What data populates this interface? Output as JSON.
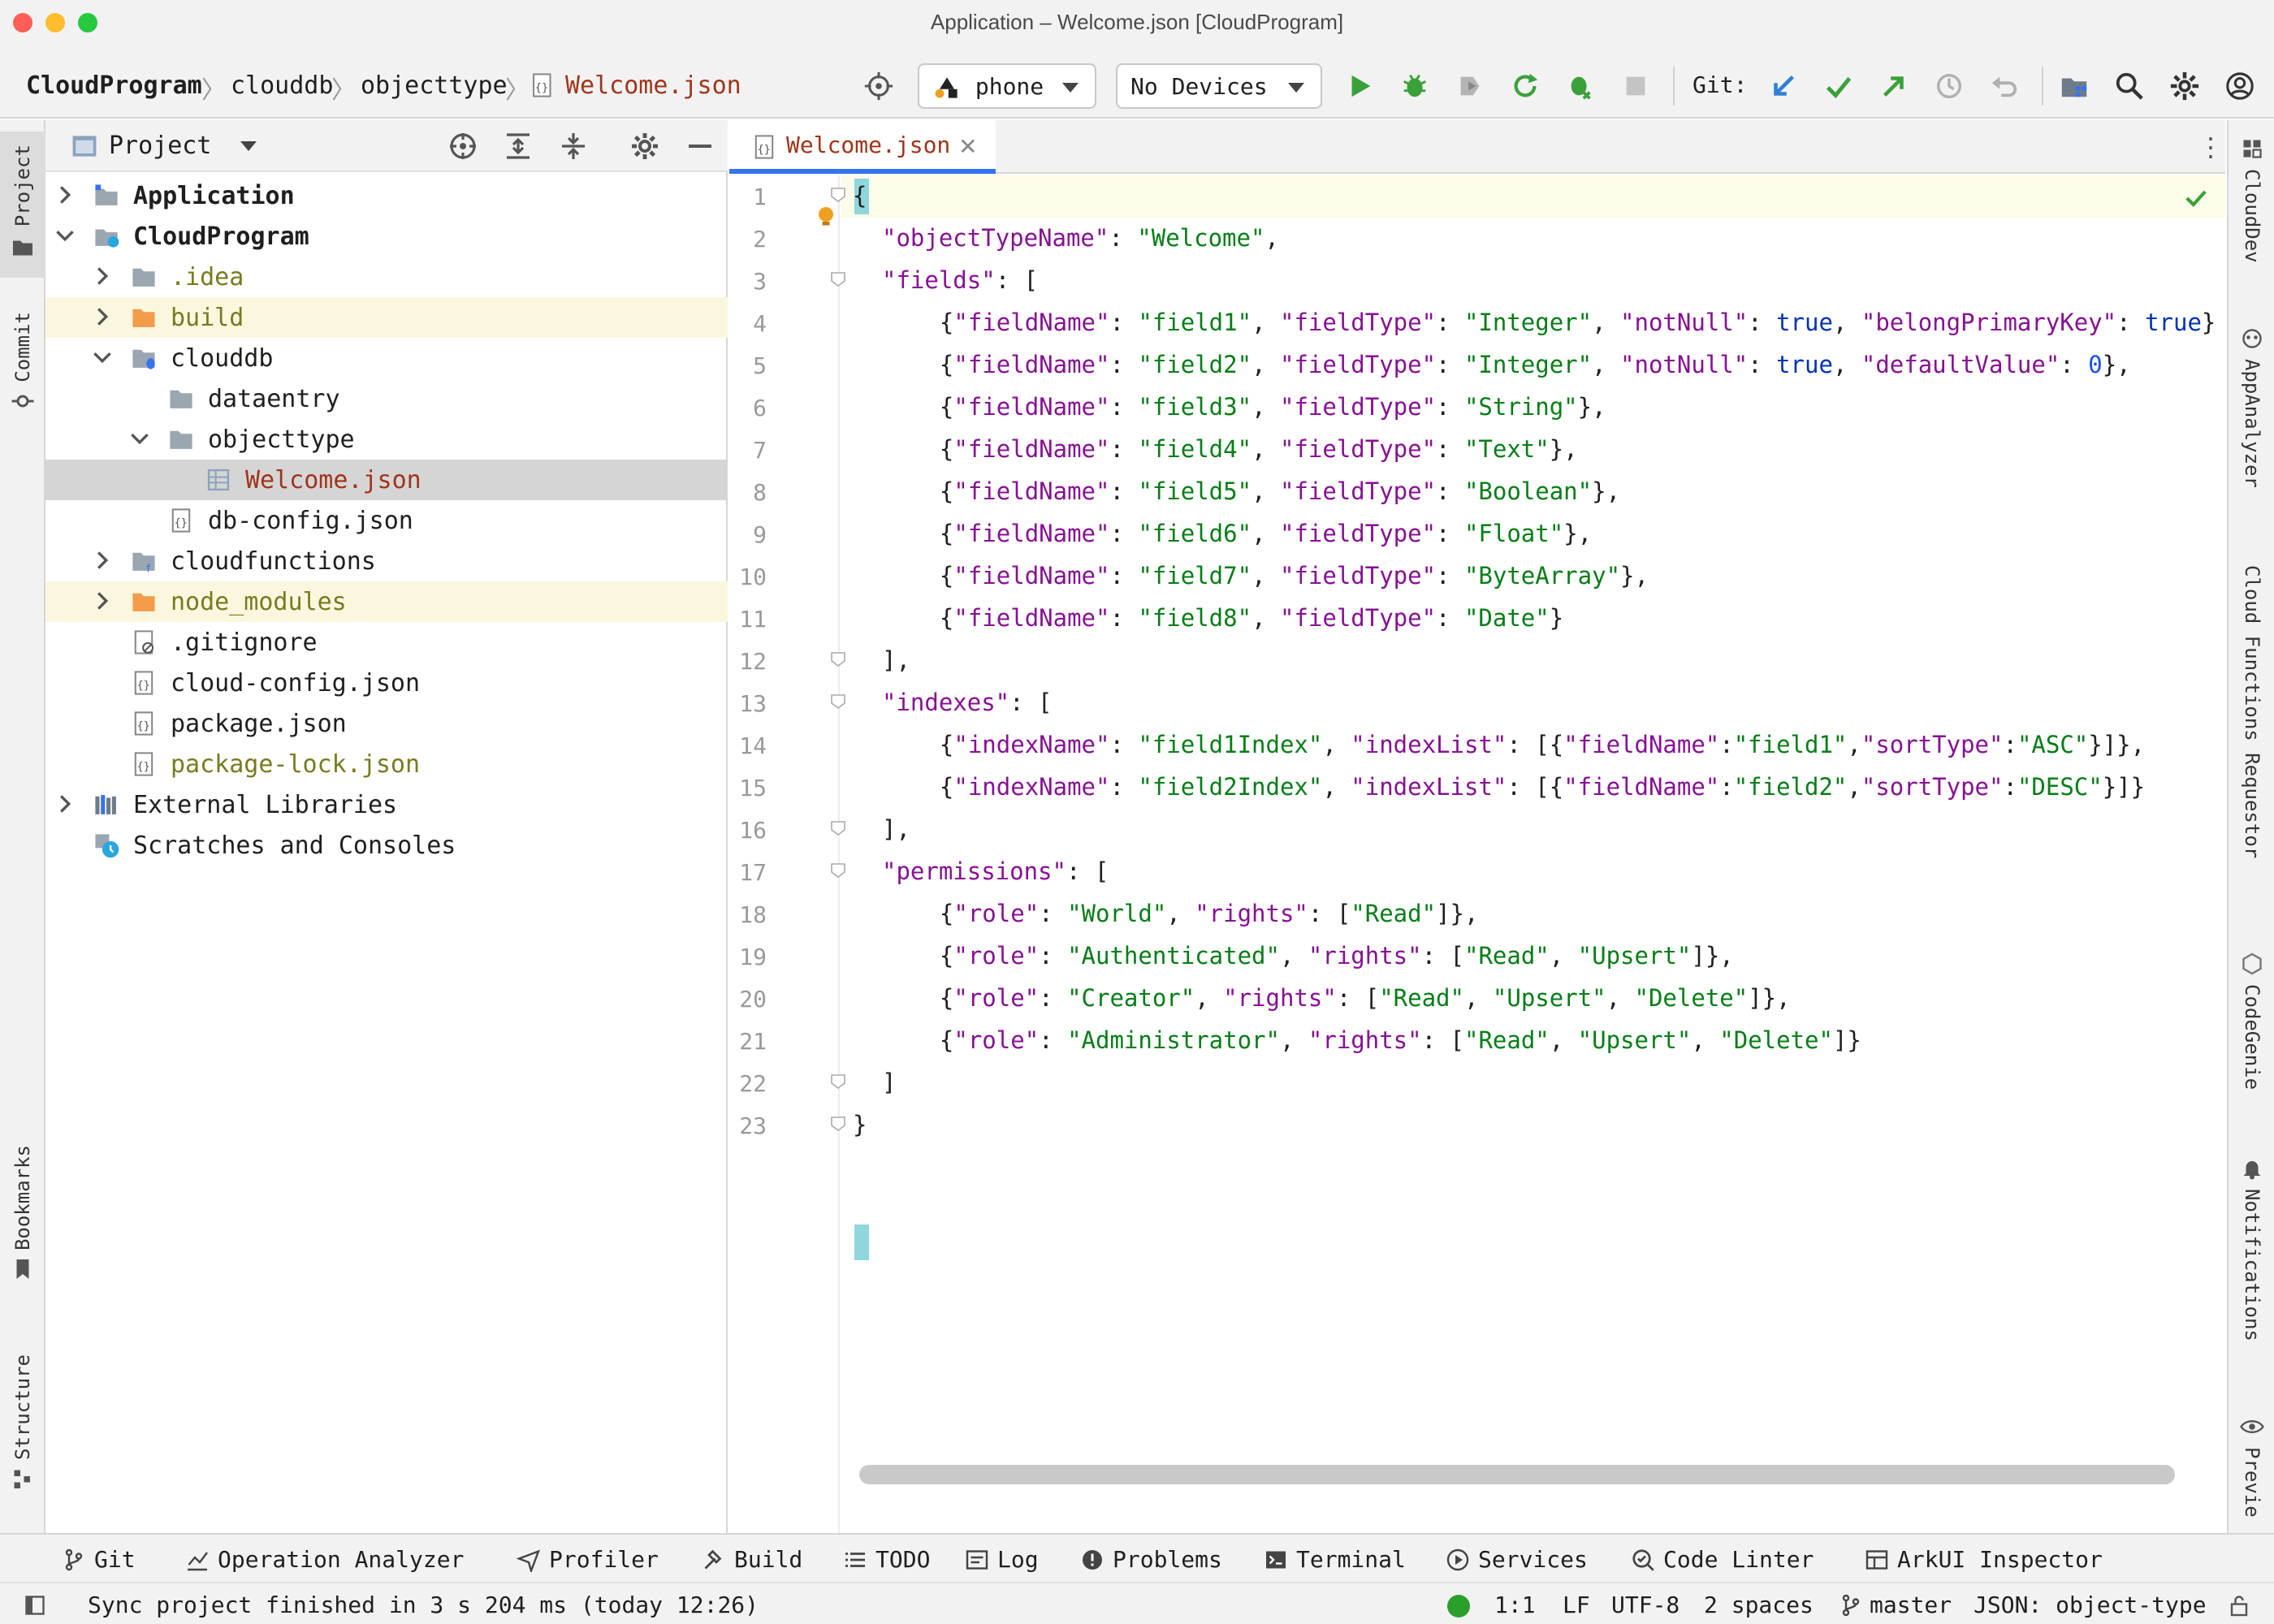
{
  "window": {
    "title": "Application – Welcome.json [CloudProgram]"
  },
  "colors": {
    "close": "#ff5f57",
    "minimize": "#febc2e",
    "zoom": "#28c840",
    "accent": "#3574f0",
    "run_green": "#3aa13a",
    "folder_orange": "#f39c4a",
    "folder_gray": "#9aa7b0"
  },
  "toolbar": {
    "breadcrumbs": [
      "CloudProgram",
      "clouddb",
      "objecttype",
      "Welcome.json"
    ],
    "device_select": "phone",
    "device_target": "No Devices",
    "git_label": "Git:"
  },
  "left_stripe": {
    "tabs": [
      "Project",
      "Commit",
      "Bookmarks",
      "Structure"
    ]
  },
  "project_panel": {
    "title": "Project",
    "tree": [
      {
        "label": "Application",
        "icon": "module-icon",
        "expanded": false
      },
      {
        "label": "CloudProgram",
        "icon": "module-icon",
        "expanded": true
      },
      {
        "label": ".idea",
        "icon": "folder-icon",
        "expanded": false
      },
      {
        "label": "build",
        "icon": "folder-icon",
        "expanded": false
      },
      {
        "label": "clouddb",
        "icon": "db-folder-icon",
        "expanded": true
      },
      {
        "label": "dataentry",
        "icon": "folder-icon"
      },
      {
        "label": "objecttype",
        "icon": "folder-icon",
        "expanded": true
      },
      {
        "label": "Welcome.json",
        "icon": "table-file-icon"
      },
      {
        "label": "db-config.json",
        "icon": "json-file-icon"
      },
      {
        "label": "cloudfunctions",
        "icon": "functions-folder-icon",
        "expanded": false
      },
      {
        "label": "node_modules",
        "icon": "folder-icon",
        "expanded": false
      },
      {
        "label": ".gitignore",
        "icon": "ignore-file-icon"
      },
      {
        "label": "cloud-config.json",
        "icon": "json-file-icon"
      },
      {
        "label": "package.json",
        "icon": "json-file-icon"
      },
      {
        "label": "package-lock.json",
        "icon": "json-file-icon"
      },
      {
        "label": "External Libraries",
        "icon": "libraries-icon",
        "expanded": false
      },
      {
        "label": "Scratches and Consoles",
        "icon": "scratches-icon"
      }
    ]
  },
  "editor": {
    "tab_label": "Welcome.json",
    "line_numbers": [
      "1",
      "2",
      "3",
      "4",
      "5",
      "6",
      "7",
      "8",
      "9",
      "10",
      "11",
      "12",
      "13",
      "14",
      "15",
      "16",
      "17",
      "18",
      "19",
      "20",
      "21",
      "22",
      "23"
    ],
    "lines": [
      [
        [
          "p",
          "{"
        ]
      ],
      [
        [
          "k",
          "\"objectTypeName\""
        ],
        [
          "p",
          ": "
        ],
        [
          "s",
          "\"Welcome\""
        ],
        [
          "p",
          ","
        ]
      ],
      [
        [
          "k",
          "\"fields\""
        ],
        [
          "p",
          ": ["
        ]
      ],
      [
        [
          "p",
          "  {"
        ],
        [
          "k",
          "\"fieldName\""
        ],
        [
          "p",
          ": "
        ],
        [
          "s",
          "\"field1\""
        ],
        [
          "p",
          ", "
        ],
        [
          "k",
          "\"fieldType\""
        ],
        [
          "p",
          ": "
        ],
        [
          "s",
          "\"Integer\""
        ],
        [
          "p",
          ", "
        ],
        [
          "k",
          "\"notNull\""
        ],
        [
          "p",
          ": "
        ],
        [
          "b",
          "true"
        ],
        [
          "p",
          ", "
        ],
        [
          "k",
          "\"belongPrimaryKey\""
        ],
        [
          "p",
          ": "
        ],
        [
          "b",
          "true"
        ],
        [
          "p",
          "}"
        ]
      ],
      [
        [
          "p",
          "  {"
        ],
        [
          "k",
          "\"fieldName\""
        ],
        [
          "p",
          ": "
        ],
        [
          "s",
          "\"field2\""
        ],
        [
          "p",
          ", "
        ],
        [
          "k",
          "\"fieldType\""
        ],
        [
          "p",
          ": "
        ],
        [
          "s",
          "\"Integer\""
        ],
        [
          "p",
          ", "
        ],
        [
          "k",
          "\"notNull\""
        ],
        [
          "p",
          ": "
        ],
        [
          "b",
          "true"
        ],
        [
          "p",
          ", "
        ],
        [
          "k",
          "\"defaultValue\""
        ],
        [
          "p",
          ": "
        ],
        [
          "n",
          "0"
        ],
        [
          "p",
          "},"
        ]
      ],
      [
        [
          "p",
          "  {"
        ],
        [
          "k",
          "\"fieldName\""
        ],
        [
          "p",
          ": "
        ],
        [
          "s",
          "\"field3\""
        ],
        [
          "p",
          ", "
        ],
        [
          "k",
          "\"fieldType\""
        ],
        [
          "p",
          ": "
        ],
        [
          "s",
          "\"String\""
        ],
        [
          "p",
          "},"
        ]
      ],
      [
        [
          "p",
          "  {"
        ],
        [
          "k",
          "\"fieldName\""
        ],
        [
          "p",
          ": "
        ],
        [
          "s",
          "\"field4\""
        ],
        [
          "p",
          ", "
        ],
        [
          "k",
          "\"fieldType\""
        ],
        [
          "p",
          ": "
        ],
        [
          "s",
          "\"Text\""
        ],
        [
          "p",
          "},"
        ]
      ],
      [
        [
          "p",
          "  {"
        ],
        [
          "k",
          "\"fieldName\""
        ],
        [
          "p",
          ": "
        ],
        [
          "s",
          "\"field5\""
        ],
        [
          "p",
          ", "
        ],
        [
          "k",
          "\"fieldType\""
        ],
        [
          "p",
          ": "
        ],
        [
          "s",
          "\"Boolean\""
        ],
        [
          "p",
          "},"
        ]
      ],
      [
        [
          "p",
          "  {"
        ],
        [
          "k",
          "\"fieldName\""
        ],
        [
          "p",
          ": "
        ],
        [
          "s",
          "\"field6\""
        ],
        [
          "p",
          ", "
        ],
        [
          "k",
          "\"fieldType\""
        ],
        [
          "p",
          ": "
        ],
        [
          "s",
          "\"Float\""
        ],
        [
          "p",
          "},"
        ]
      ],
      [
        [
          "p",
          "  {"
        ],
        [
          "k",
          "\"fieldName\""
        ],
        [
          "p",
          ": "
        ],
        [
          "s",
          "\"field7\""
        ],
        [
          "p",
          ", "
        ],
        [
          "k",
          "\"fieldType\""
        ],
        [
          "p",
          ": "
        ],
        [
          "s",
          "\"ByteArray\""
        ],
        [
          "p",
          "},"
        ]
      ],
      [
        [
          "p",
          "  {"
        ],
        [
          "k",
          "\"fieldName\""
        ],
        [
          "p",
          ": "
        ],
        [
          "s",
          "\"field8\""
        ],
        [
          "p",
          ", "
        ],
        [
          "k",
          "\"fieldType\""
        ],
        [
          "p",
          ": "
        ],
        [
          "s",
          "\"Date\""
        ],
        [
          "p",
          "}"
        ]
      ],
      [
        [
          "p",
          "],"
        ]
      ],
      [
        [
          "k",
          "\"indexes\""
        ],
        [
          "p",
          ": ["
        ]
      ],
      [
        [
          "p",
          "  {"
        ],
        [
          "k",
          "\"indexName\""
        ],
        [
          "p",
          ": "
        ],
        [
          "s",
          "\"field1Index\""
        ],
        [
          "p",
          ", "
        ],
        [
          "k",
          "\"indexList\""
        ],
        [
          "p",
          ": [{"
        ],
        [
          "k",
          "\"fieldName\""
        ],
        [
          "p",
          ":"
        ],
        [
          "s",
          "\"field1\""
        ],
        [
          "p",
          ","
        ],
        [
          "k",
          "\"sortType\""
        ],
        [
          "p",
          ":"
        ],
        [
          "s",
          "\"ASC\""
        ],
        [
          "p",
          "}]},"
        ]
      ],
      [
        [
          "p",
          "  {"
        ],
        [
          "k",
          "\"indexName\""
        ],
        [
          "p",
          ": "
        ],
        [
          "s",
          "\"field2Index\""
        ],
        [
          "p",
          ", "
        ],
        [
          "k",
          "\"indexList\""
        ],
        [
          "p",
          ": [{"
        ],
        [
          "k",
          "\"fieldName\""
        ],
        [
          "p",
          ":"
        ],
        [
          "s",
          "\"field2\""
        ],
        [
          "p",
          ","
        ],
        [
          "k",
          "\"sortType\""
        ],
        [
          "p",
          ":"
        ],
        [
          "s",
          "\"DESC\""
        ],
        [
          "p",
          "}]}"
        ]
      ],
      [
        [
          "p",
          "],"
        ]
      ],
      [
        [
          "k",
          "\"permissions\""
        ],
        [
          "p",
          ": ["
        ]
      ],
      [
        [
          "p",
          "  {"
        ],
        [
          "k",
          "\"role\""
        ],
        [
          "p",
          ": "
        ],
        [
          "s",
          "\"World\""
        ],
        [
          "p",
          ", "
        ],
        [
          "k",
          "\"rights\""
        ],
        [
          "p",
          ": ["
        ],
        [
          "s",
          "\"Read\""
        ],
        [
          "p",
          "]},"
        ]
      ],
      [
        [
          "p",
          "  {"
        ],
        [
          "k",
          "\"role\""
        ],
        [
          "p",
          ": "
        ],
        [
          "s",
          "\"Authenticated\""
        ],
        [
          "p",
          ", "
        ],
        [
          "k",
          "\"rights\""
        ],
        [
          "p",
          ": ["
        ],
        [
          "s",
          "\"Read\""
        ],
        [
          "p",
          ", "
        ],
        [
          "s",
          "\"Upsert\""
        ],
        [
          "p",
          "]},"
        ]
      ],
      [
        [
          "p",
          "  {"
        ],
        [
          "k",
          "\"role\""
        ],
        [
          "p",
          ": "
        ],
        [
          "s",
          "\"Creator\""
        ],
        [
          "p",
          ", "
        ],
        [
          "k",
          "\"rights\""
        ],
        [
          "p",
          ": ["
        ],
        [
          "s",
          "\"Read\""
        ],
        [
          "p",
          ", "
        ],
        [
          "s",
          "\"Upsert\""
        ],
        [
          "p",
          ", "
        ],
        [
          "s",
          "\"Delete\""
        ],
        [
          "p",
          "]},"
        ]
      ],
      [
        [
          "p",
          "  {"
        ],
        [
          "k",
          "\"role\""
        ],
        [
          "p",
          ": "
        ],
        [
          "s",
          "\"Administrator\""
        ],
        [
          "p",
          ", "
        ],
        [
          "k",
          "\"rights\""
        ],
        [
          "p",
          ": ["
        ],
        [
          "s",
          "\"Read\""
        ],
        [
          "p",
          ", "
        ],
        [
          "s",
          "\"Upsert\""
        ],
        [
          "p",
          ", "
        ],
        [
          "s",
          "\"Delete\""
        ],
        [
          "p",
          "]}"
        ]
      ],
      [
        [
          "p",
          "]"
        ]
      ],
      [
        [
          "p",
          "}"
        ]
      ]
    ]
  },
  "right_stripe": {
    "tabs": [
      "CloudDev",
      "AppAnalyzer",
      "Cloud Functions Requestor",
      "CodeGenie",
      "Notifications",
      "Previe"
    ]
  },
  "bottom_tools": [
    "Git",
    "Operation Analyzer",
    "Profiler",
    "Build",
    "TODO",
    "Log",
    "Problems",
    "Terminal",
    "Services",
    "Code Linter",
    "ArkUI Inspector"
  ],
  "status": {
    "message": "Sync project finished in 3 s 204 ms (today 12:26)",
    "position": "1:1",
    "line_ending": "LF",
    "encoding": "UTF-8",
    "indent": "2 spaces",
    "branch": "master",
    "schema": "JSON: object-type"
  }
}
